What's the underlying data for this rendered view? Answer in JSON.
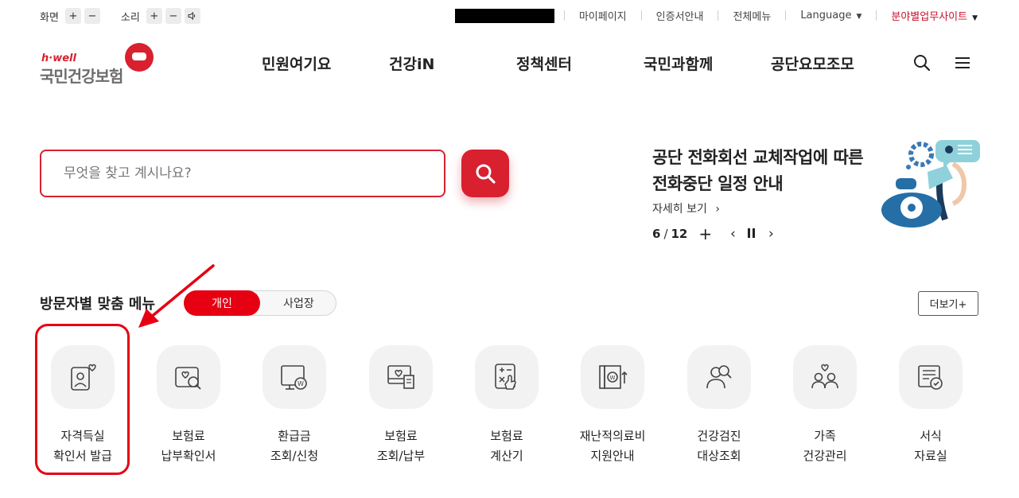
{
  "utility": {
    "screen_label": "화면",
    "sound_label": "소리",
    "plus": "+",
    "minus": "−",
    "links": [
      "마이페이지",
      "인증서안내",
      "전체메뉴"
    ],
    "language": "Language",
    "field_site": "분야별업무사이트"
  },
  "logo": {
    "tagline": "h·well",
    "name": "국민건강보험"
  },
  "gnb": [
    "민원여기요",
    "건강iN",
    "정책센터",
    "국민과함께",
    "공단요모조모"
  ],
  "icons": {
    "search": "search-icon",
    "menu": "hamburger-menu-icon",
    "speaker": "speaker-icon"
  },
  "search": {
    "placeholder": "무엇을 찾고 계시나요?"
  },
  "notice": {
    "title": "공단 전화회선 교체작업에 따른 전화중단 일정 안내",
    "more": "자세히 보기",
    "current": "6",
    "divider": "/",
    "total": "12"
  },
  "visitor_menu": {
    "title": "방문자별 맞춤 메뉴",
    "tab_personal": "개인",
    "tab_business": "사업장",
    "more": "더보기+",
    "items": [
      {
        "label": "자격득실\n확인서 발급",
        "icon": "certificate-icon"
      },
      {
        "label": "보험료\n납부확인서",
        "icon": "payment-confirm-icon"
      },
      {
        "label": "환급금\n조회/신청",
        "icon": "refund-icon"
      },
      {
        "label": "보험료\n조회/납부",
        "icon": "premium-inquiry-icon"
      },
      {
        "label": "보험료\n계산기",
        "icon": "calculator-icon"
      },
      {
        "label": "재난적의료비\n지원안내",
        "icon": "medical-support-icon"
      },
      {
        "label": "건강검진\n대상조회",
        "icon": "health-checkup-icon"
      },
      {
        "label": "가족\n건강관리",
        "icon": "family-health-icon"
      },
      {
        "label": "서식\n자료실",
        "icon": "forms-library-icon"
      }
    ]
  },
  "colors": {
    "brand_red": "#d8202f",
    "toggle_active": "#e60012",
    "annotation": "#e60012"
  }
}
